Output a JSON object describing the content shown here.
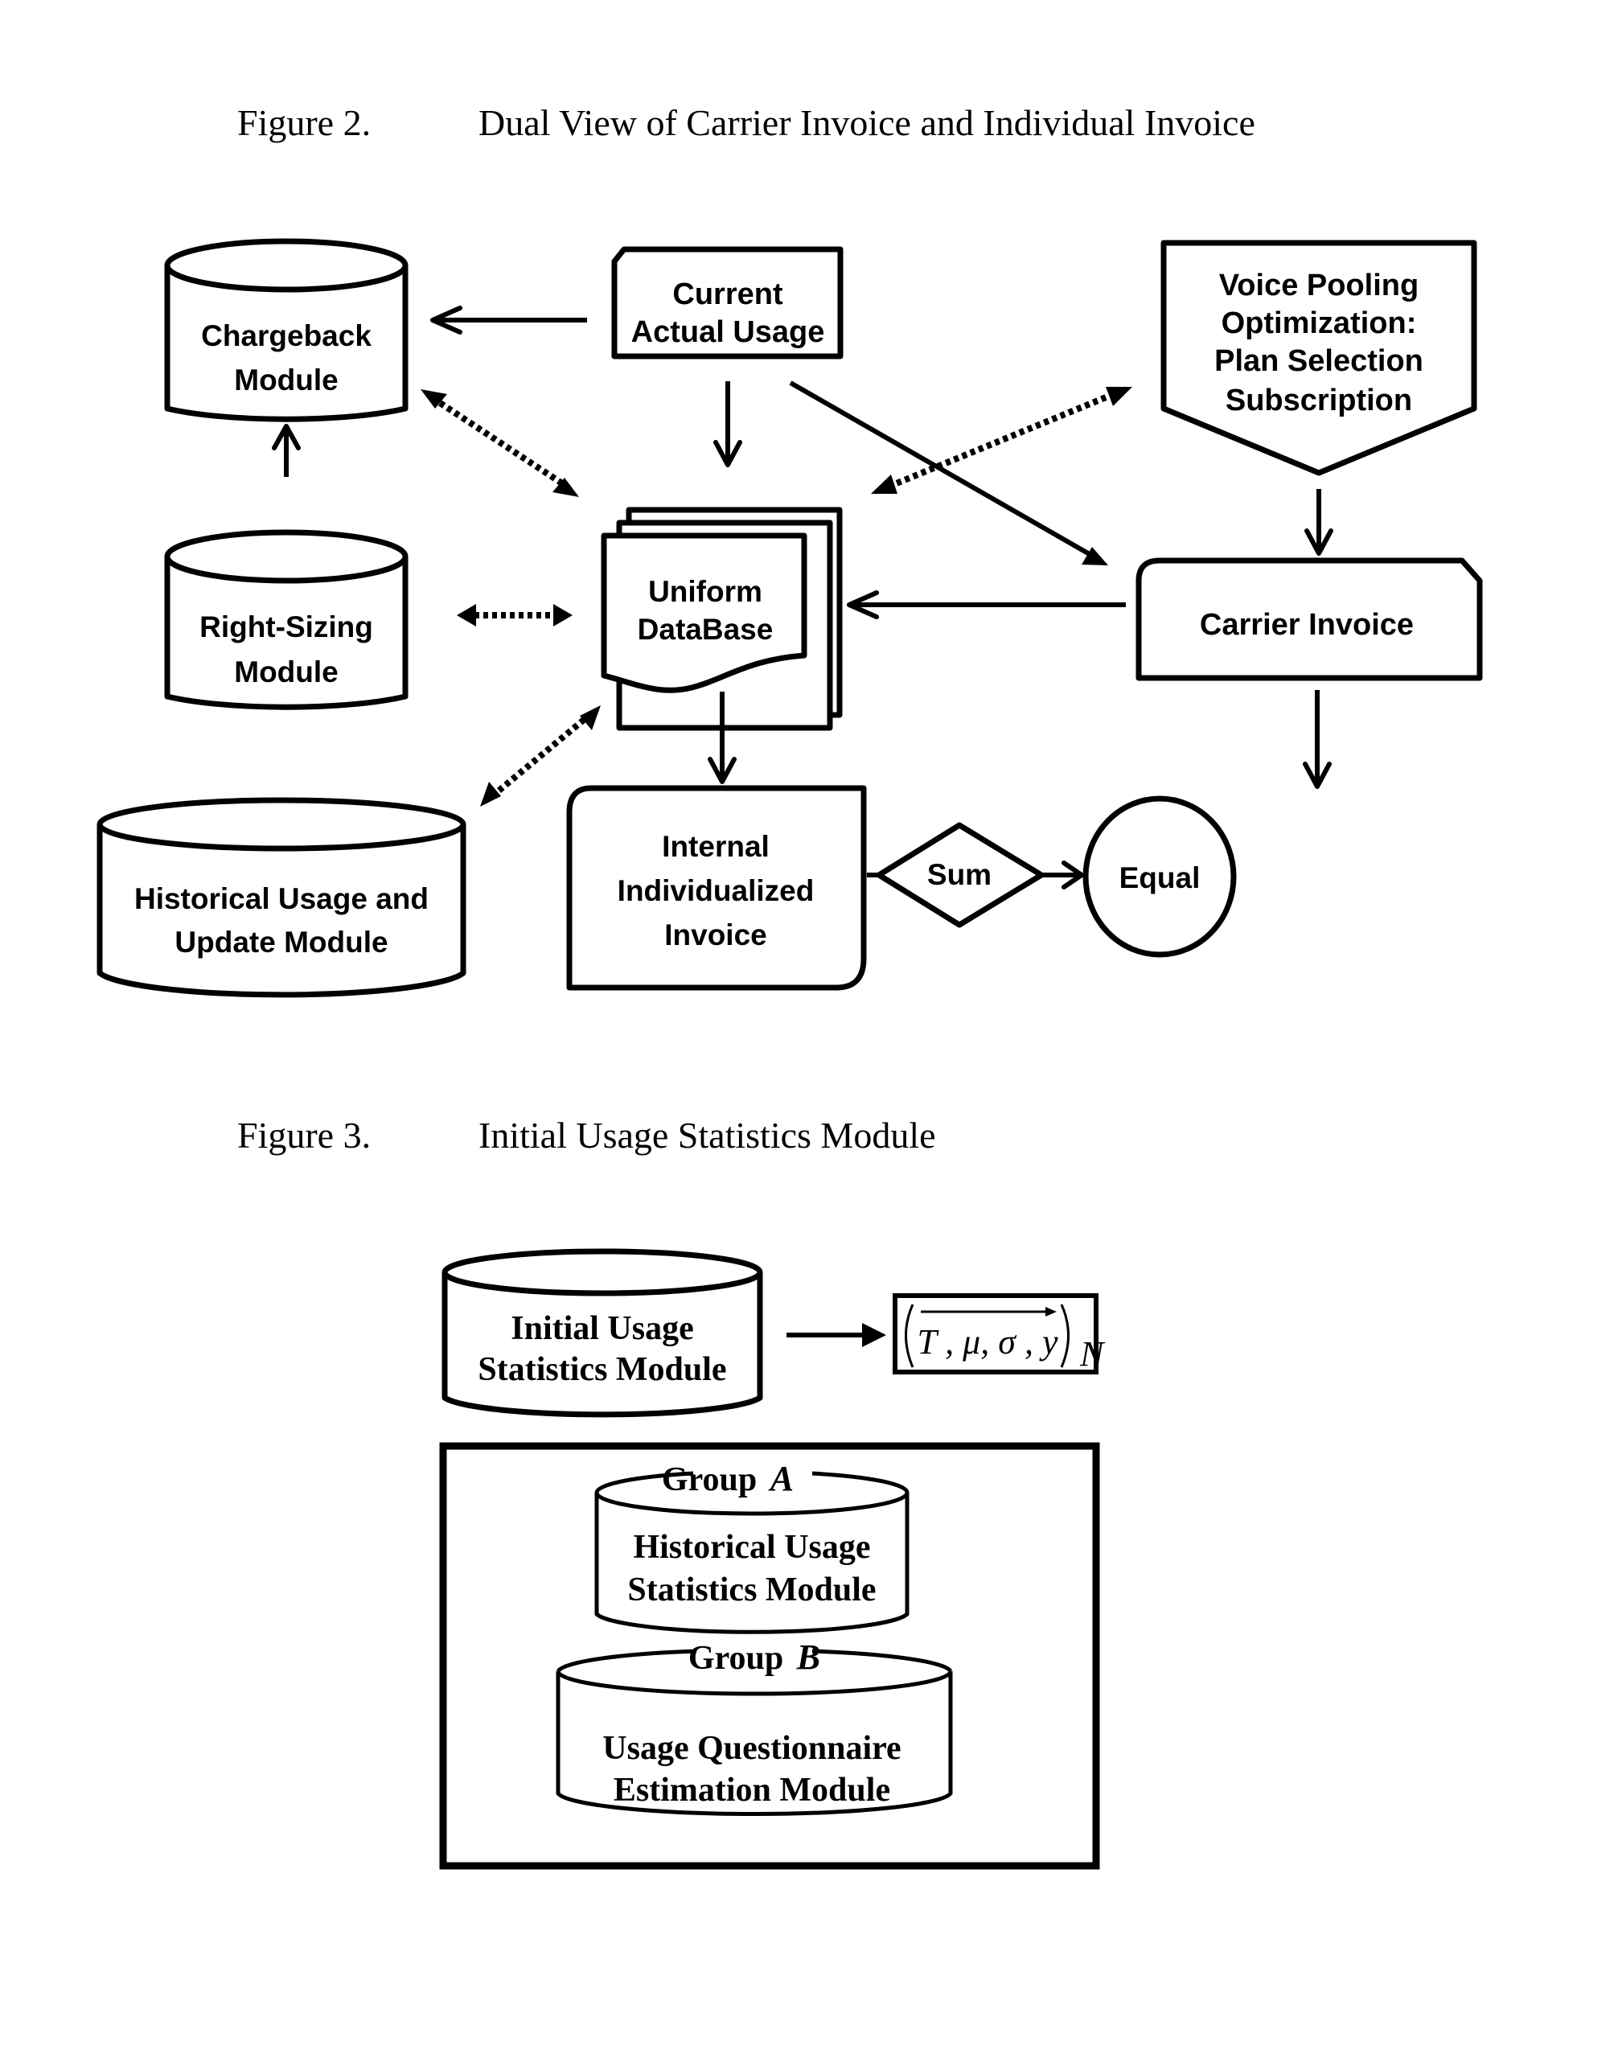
{
  "figure2": {
    "number": "Figure 2.",
    "title": "Dual View of Carrier Invoice and Individual Invoice",
    "nodes": {
      "chargeback": [
        "Chargeback",
        "Module"
      ],
      "current_usage": [
        "Current",
        "Actual Usage"
      ],
      "voice_pooling": [
        "Voice Pooling",
        "Optimization:",
        "Plan Selection",
        "Subscription"
      ],
      "right_sizing": [
        "Right-Sizing",
        "Module"
      ],
      "uniform_db": [
        "Uniform",
        "DataBase"
      ],
      "carrier_invoice": "Carrier Invoice",
      "historical": [
        "Historical Usage and",
        "Update Module"
      ],
      "internal_invoice": [
        "Internal",
        "Individualized",
        "Invoice"
      ],
      "sum": "Sum",
      "equal": "Equal"
    }
  },
  "figure3": {
    "number": "Figure 3.",
    "title": "Initial Usage Statistics Module",
    "initial_module": [
      "Initial Usage",
      "Statistics Module"
    ],
    "formula": {
      "vars": "T , μ, σ , y",
      "subscript": "N"
    },
    "group_a": {
      "label": "Group",
      "letter": "A",
      "module": [
        "Historical Usage",
        "Statistics Module"
      ]
    },
    "group_b": {
      "label": "Group",
      "letter": "B",
      "module": [
        "Usage Questionnaire",
        "Estimation Module"
      ]
    }
  }
}
